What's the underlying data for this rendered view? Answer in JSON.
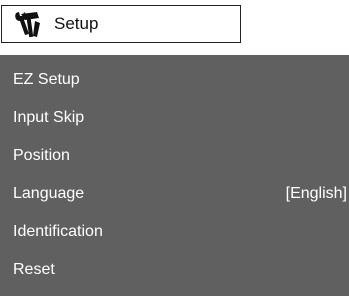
{
  "header": {
    "icon": "wrench-hammer-icon",
    "title": "Setup"
  },
  "menu": {
    "items": [
      {
        "label": "EZ Setup"
      },
      {
        "label": "Input Skip"
      },
      {
        "label": "Position"
      },
      {
        "label": "Language",
        "value": "[English]"
      },
      {
        "label": "Identification"
      },
      {
        "label": "Reset"
      }
    ]
  },
  "colors": {
    "menu_bg": "#606060",
    "menu_text": "#ffffff"
  }
}
